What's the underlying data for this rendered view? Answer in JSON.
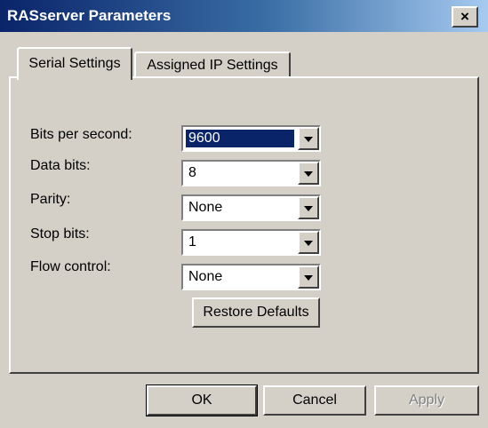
{
  "window": {
    "title": "RASserver Parameters",
    "close_label": "×"
  },
  "tabs": [
    {
      "label": "Serial Settings"
    },
    {
      "label": "Assigned IP Settings"
    }
  ],
  "fields": [
    {
      "label": "Bits per second:",
      "value": "9600"
    },
    {
      "label": "Data bits:",
      "value": "8"
    },
    {
      "label": "Parity:",
      "value": "None"
    },
    {
      "label": "Stop bits:",
      "value": "1"
    },
    {
      "label": "Flow control:",
      "value": "None"
    }
  ],
  "restore_label": "Restore Defaults",
  "buttons": {
    "ok": "OK",
    "cancel": "Cancel",
    "apply": "Apply"
  }
}
